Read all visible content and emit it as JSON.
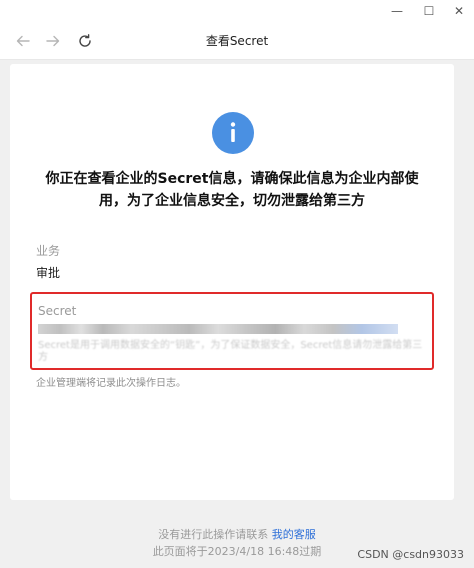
{
  "window": {
    "minimize_glyph": "—",
    "maximize_glyph": "☐",
    "close_glyph": "✕"
  },
  "navbar": {
    "title": "查看Secret"
  },
  "dialog": {
    "headline_line1": "你正在查看企业的Secret信息，请确保此信息为企业内部使",
    "headline_line2": "用，为了企业信息安全，切勿泄露给第三方",
    "business": {
      "label": "业务",
      "value": "审批"
    },
    "secret": {
      "label": "Secret",
      "obscured_note": "Secret是用于调用数据安全的“钥匙”，为了保证数据安全，Secret信息请勿泄露给第三方"
    },
    "log_note": "企业管理端将记录此次操作日志。"
  },
  "footer": {
    "prompt": "没有进行此操作请联系",
    "contact_link": "我的客服",
    "expiry": "此页面将于2023/4/18 16:48过期"
  },
  "watermark": "CSDN @csdn93033",
  "colors": {
    "accent": "#4a90e2",
    "highlight_border": "#e02a2a",
    "link": "#2d6fd8"
  }
}
